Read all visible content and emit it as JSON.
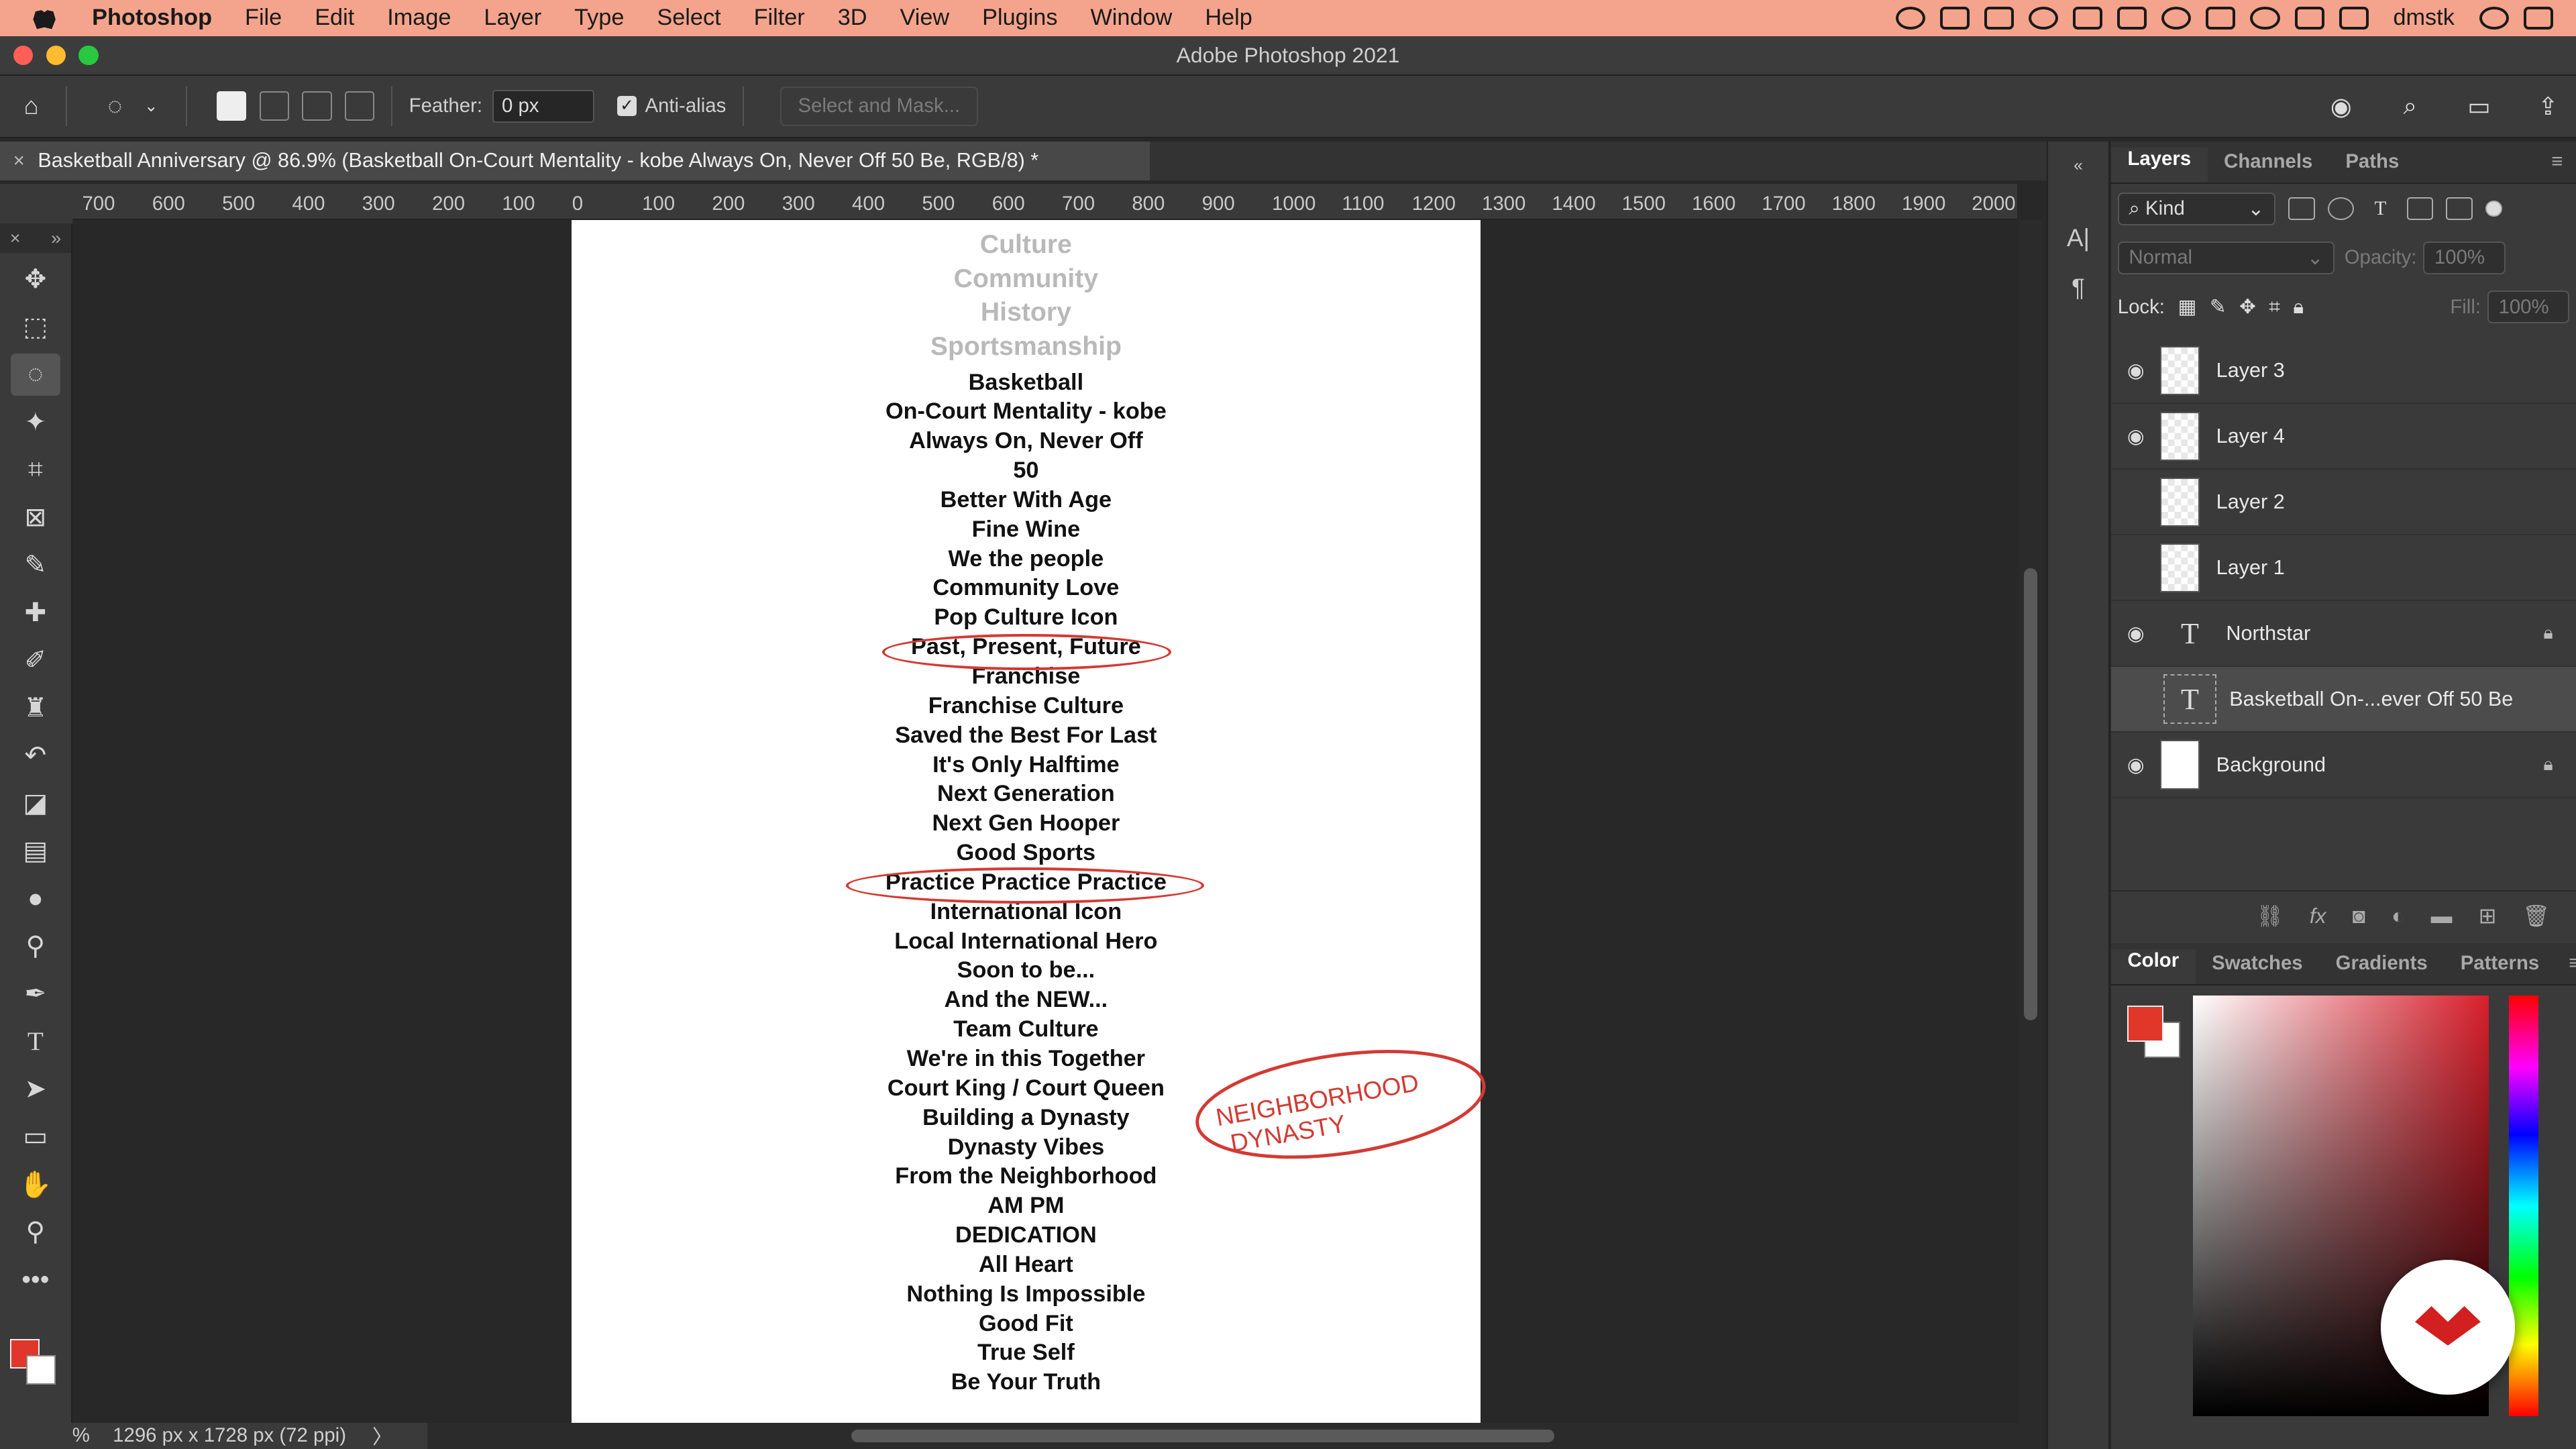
{
  "menubar": {
    "app": "Photoshop",
    "items": [
      "File",
      "Edit",
      "Image",
      "Layer",
      "Type",
      "Select",
      "Filter",
      "3D",
      "View",
      "Plugins",
      "Window",
      "Help"
    ],
    "user": "dmstk"
  },
  "window": {
    "title": "Adobe Photoshop 2021"
  },
  "options": {
    "feather_label": "Feather:",
    "feather_value": "0 px",
    "antialias_label": "Anti-alias",
    "select_mask_label": "Select and Mask..."
  },
  "document": {
    "tab_title": "Basketball Anniversary @ 86.9% (Basketball On-Court Mentality - kobe Always On, Never Off 50 Be, RGB/8) *",
    "status": "1296 px x 1728 px (72 ppi)",
    "zoom_glyph": "%",
    "status_arrow": "〉",
    "ruler_ticks": [
      "700",
      "600",
      "500",
      "400",
      "300",
      "200",
      "100",
      "0",
      "100",
      "200",
      "300",
      "400",
      "500",
      "600",
      "700",
      "800",
      "900",
      "1000",
      "1100",
      "1200",
      "1300",
      "1400",
      "1500",
      "1600",
      "1700",
      "1800",
      "1900",
      "2000"
    ],
    "gray_lines": [
      "Culture",
      "Community",
      "History",
      "Sportsmanship"
    ],
    "lines": [
      "Basketball",
      "On-Court Mentality - kobe",
      "Always On, Never Off",
      "50",
      "Better With Age",
      "Fine Wine",
      "We the people",
      "Community Love",
      "Pop Culture Icon",
      "Past, Present, Future",
      "Franchise",
      "Franchise Culture",
      "Saved the Best For Last",
      "It's Only Halftime",
      "Next Generation",
      "Next Gen Hooper",
      "Good Sports",
      "Practice Practice Practice",
      "International Icon",
      "Local International Hero",
      "Soon to be...",
      "And the NEW...",
      "Team Culture",
      "We're in this Together",
      "Court King / Court Queen",
      "Building a Dynasty",
      "Dynasty Vibes",
      "From the Neighborhood",
      "AM PM",
      "DEDICATION",
      "All Heart",
      "Nothing Is Impossible",
      "Good Fit",
      "True Self",
      "Be Your Truth"
    ],
    "annotation": "NEIGHBORHOOD DYNASTY"
  },
  "layers_panel": {
    "tabs": [
      "Layers",
      "Channels",
      "Paths"
    ],
    "kind_label": "Kind",
    "blend_mode": "Normal",
    "opacity_label": "Opacity:",
    "opacity_value": "100%",
    "lock_label": "Lock:",
    "fill_label": "Fill:",
    "fill_value": "100%",
    "layers": [
      {
        "name": "Layer 3",
        "visible": true,
        "kind": "pixel"
      },
      {
        "name": "Layer 4",
        "visible": true,
        "kind": "pixel"
      },
      {
        "name": "Layer 2",
        "visible": false,
        "kind": "pixel"
      },
      {
        "name": "Layer 1",
        "visible": false,
        "kind": "pixel"
      },
      {
        "name": "Northstar",
        "visible": true,
        "kind": "type",
        "locked": true
      },
      {
        "name": "Basketball On-...ever Off 50 Be",
        "visible": false,
        "kind": "type",
        "selected": true
      },
      {
        "name": "Background",
        "visible": true,
        "kind": "background",
        "locked": true
      }
    ]
  },
  "color_panel": {
    "tabs": [
      "Color",
      "Swatches",
      "Gradients",
      "Patterns"
    ],
    "foreground": "#e0372a",
    "background": "#ffffff"
  }
}
